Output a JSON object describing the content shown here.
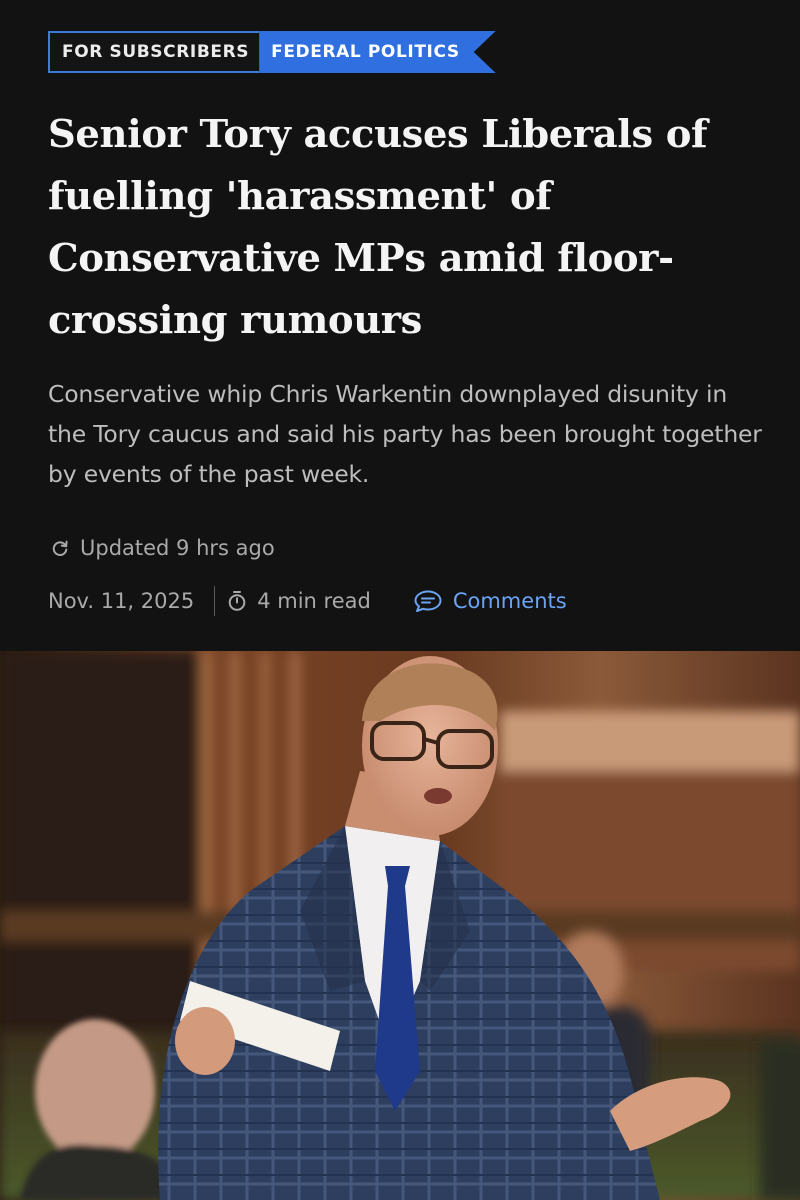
{
  "tags": {
    "subscribers": "FOR SUBSCRIBERS",
    "section": "FEDERAL POLITICS"
  },
  "article": {
    "headline": "Senior Tory accuses Liberals of fuelling 'harassment' of Conservative MPs amid floor-crossing rumours",
    "dek": "Conservative whip Chris Warkentin downplayed disunity in the Tory caucus and said his party has been brought together by events of the past week.",
    "updated": "Updated 9 hrs ago",
    "date": "Nov. 11, 2025",
    "read_time": "4 min read",
    "comments_label": "Comments"
  },
  "colors": {
    "background": "#121212",
    "accent": "#2f6fe0",
    "link": "#6aa4f2"
  },
  "icons": {
    "updated": "refresh-icon",
    "read_time": "stopwatch-icon",
    "comments": "speech-bubble-icon"
  }
}
